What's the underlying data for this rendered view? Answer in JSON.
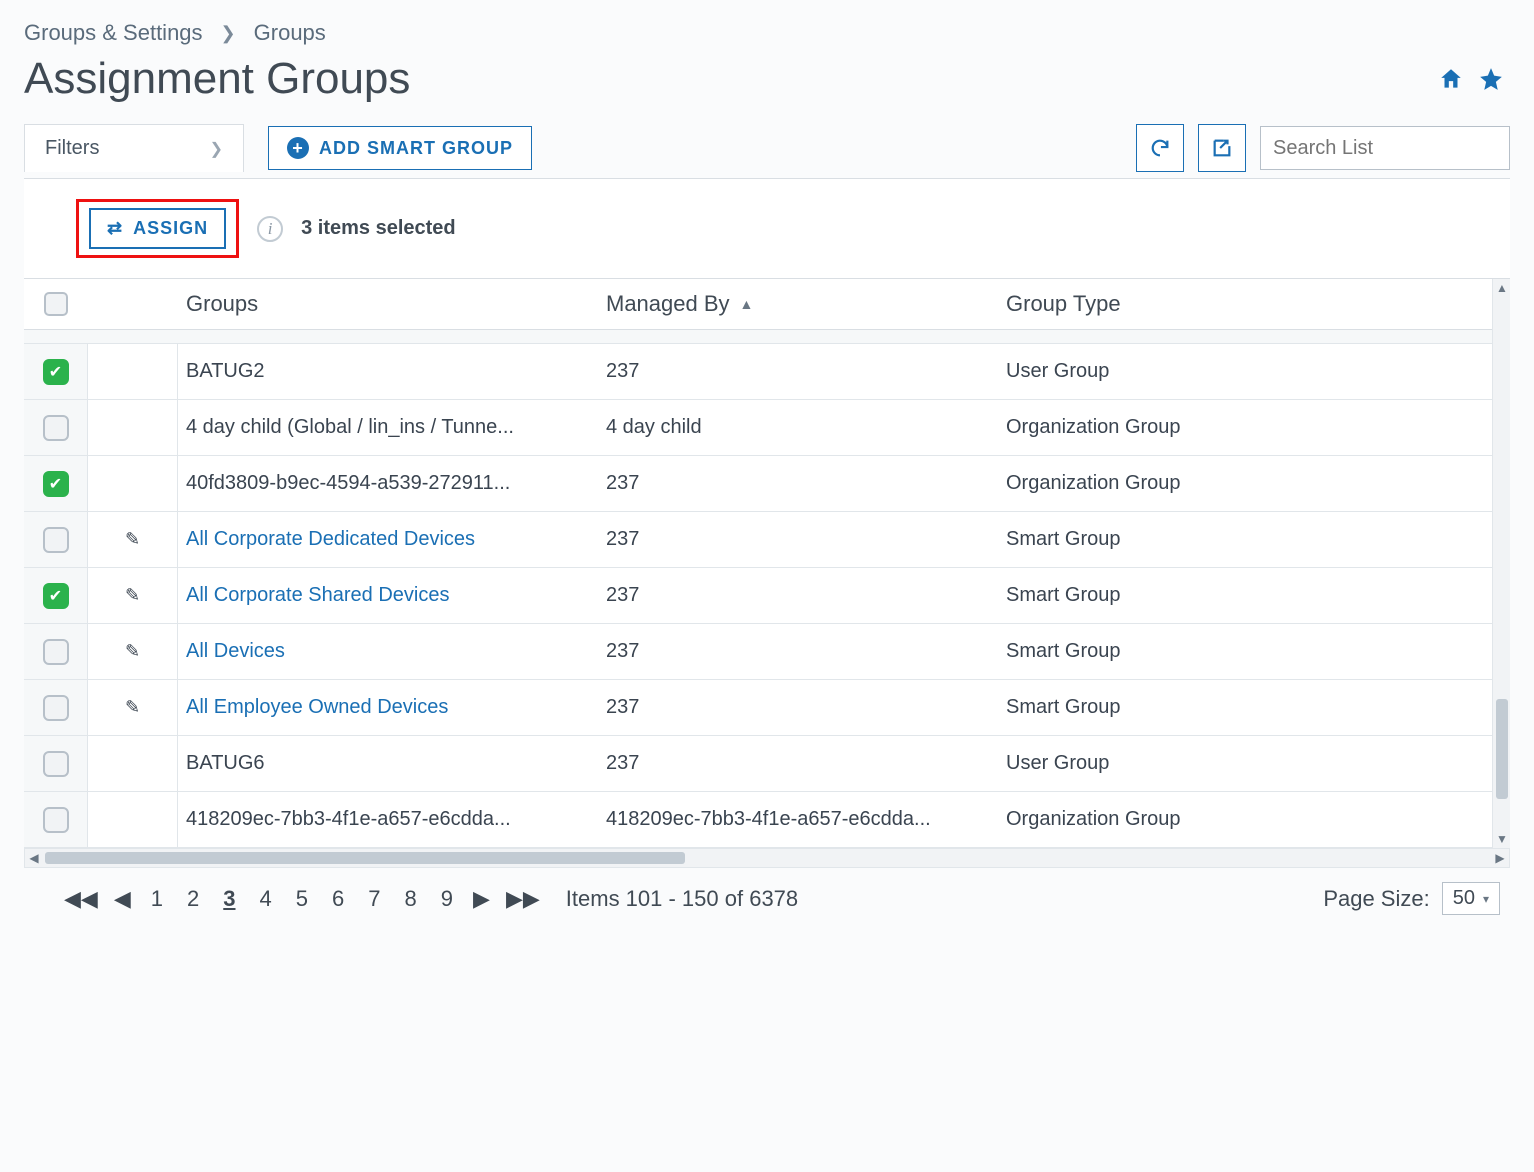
{
  "breadcrumb": {
    "root": "Groups & Settings",
    "current": "Groups"
  },
  "page_title": "Assignment Groups",
  "toolbar": {
    "filters_label": "Filters",
    "add_smart_group_label": "ADD SMART GROUP",
    "search_placeholder": "Search List"
  },
  "actions": {
    "assign_label": "ASSIGN",
    "selected_text": "3 items selected"
  },
  "table": {
    "headers": {
      "groups": "Groups",
      "managed_by": "Managed By",
      "group_type": "Group Type"
    },
    "rows": [
      {
        "checked": true,
        "editable": false,
        "group": "BATUG2",
        "link": false,
        "managed_by": "237",
        "group_type": "User Group"
      },
      {
        "checked": false,
        "editable": false,
        "group": "4 day child (Global / lin_ins / Tunne...",
        "link": false,
        "managed_by": "4 day child",
        "group_type": "Organization Group"
      },
      {
        "checked": true,
        "editable": false,
        "group": "40fd3809-b9ec-4594-a539-272911...",
        "link": false,
        "managed_by": "237",
        "group_type": "Organization Group"
      },
      {
        "checked": false,
        "editable": true,
        "group": "All Corporate Dedicated Devices",
        "link": true,
        "managed_by": "237",
        "group_type": "Smart Group"
      },
      {
        "checked": true,
        "editable": true,
        "group": "All Corporate Shared Devices",
        "link": true,
        "managed_by": "237",
        "group_type": "Smart Group"
      },
      {
        "checked": false,
        "editable": true,
        "group": "All Devices",
        "link": true,
        "managed_by": "237",
        "group_type": "Smart Group"
      },
      {
        "checked": false,
        "editable": true,
        "group": "All Employee Owned Devices",
        "link": true,
        "managed_by": "237",
        "group_type": "Smart Group"
      },
      {
        "checked": false,
        "editable": false,
        "group": "BATUG6",
        "link": false,
        "managed_by": "237",
        "group_type": "User Group"
      },
      {
        "checked": false,
        "editable": false,
        "group": "418209ec-7bb3-4f1e-a657-e6cdda...",
        "link": false,
        "managed_by": "418209ec-7bb3-4f1e-a657-e6cdda...",
        "group_type": "Organization Group"
      }
    ]
  },
  "pager": {
    "pages": [
      "1",
      "2",
      "3",
      "4",
      "5",
      "6",
      "7",
      "8",
      "9"
    ],
    "current_page": "3",
    "range_text": "Items 101 - 150 of 6378",
    "page_size_label": "Page Size:",
    "page_size_value": "50"
  }
}
